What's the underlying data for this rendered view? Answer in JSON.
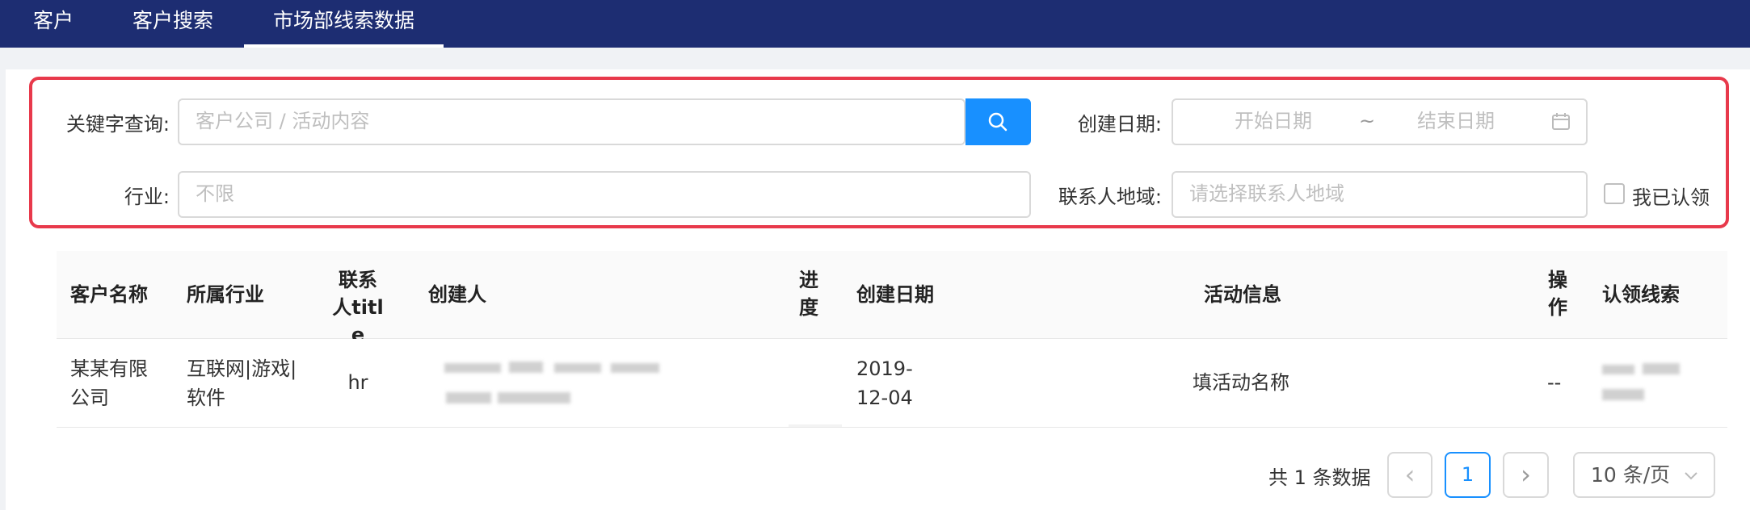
{
  "nav": {
    "tabs": [
      {
        "label": "客户"
      },
      {
        "label": "客户搜索"
      },
      {
        "label": "市场部线索数据",
        "active": true
      }
    ]
  },
  "filters": {
    "keyword_label": "关键字查询:",
    "keyword_placeholder": "客户公司 / 活动内容",
    "created_date_label": "创建日期:",
    "start_date_placeholder": "开始日期",
    "date_separator": "~",
    "end_date_placeholder": "结束日期",
    "industry_label": "行业:",
    "industry_value": "不限",
    "region_label": "联系人地域:",
    "region_placeholder": "请选择联系人地域",
    "claimed_label": "我已认领",
    "claimed_checked": false
  },
  "table": {
    "columns": [
      "客户名称",
      "所属行业",
      "联系人title",
      "创建人",
      "进度",
      "创建日期",
      "活动信息",
      "操作",
      "认领线索"
    ],
    "rows": [
      {
        "customer_name": "某某有限公司",
        "industry": "互联网|游戏|软件",
        "contact_title": "hr",
        "creator": "",
        "progress": "",
        "created_date": "2019-12-04",
        "activity": "填活动名称",
        "operation": "--",
        "claim": ""
      }
    ]
  },
  "pagination": {
    "total_text": "共 1 条数据",
    "current_page": "1",
    "prev_icon": "‹",
    "next_icon": "›",
    "page_size": "10 条/页"
  },
  "colors": {
    "nav_bg": "#1d2d72",
    "accent": "#1890ff",
    "highlight_border": "#e8394b"
  },
  "icons": {
    "search": "search-icon",
    "calendar": "calendar-icon",
    "chevron_left": "chevron-left-icon",
    "chevron_right": "chevron-right-icon",
    "chevron_down": "chevron-down-icon"
  }
}
